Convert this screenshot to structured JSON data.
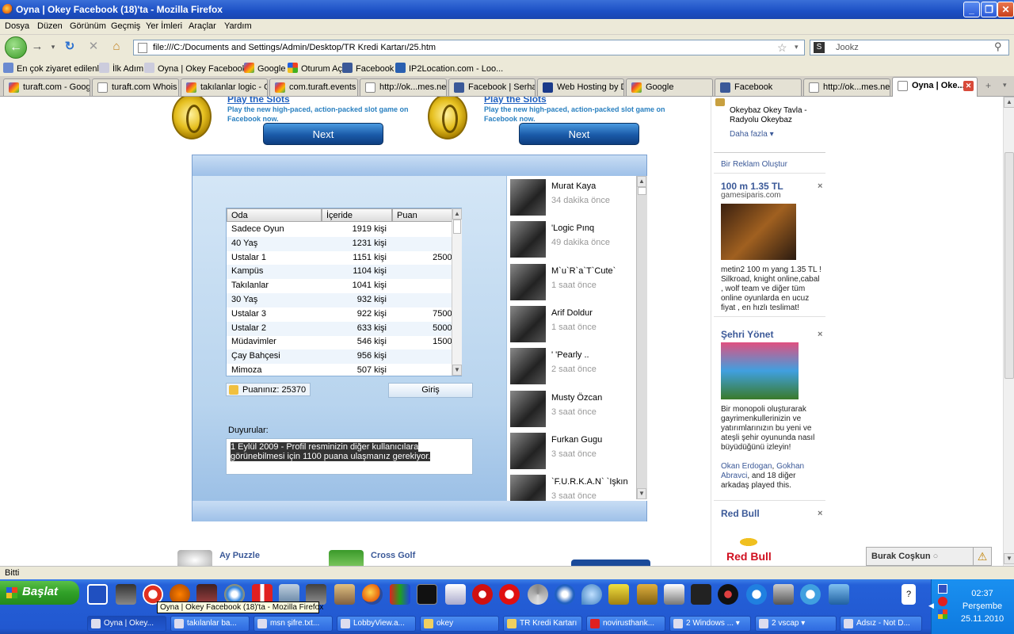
{
  "window": {
    "title": "Oyna | Okey Facebook (18)'ta - Mozilla Firefox"
  },
  "menu": [
    "Dosya",
    "Düzen",
    "Görünüm",
    "Geçmiş",
    "Yer İmleri",
    "Araçlar",
    "Yardım"
  ],
  "nav": {
    "url": "file:///C:/Documents and Settings/Admin/Desktop/TR Kredi Kartarı/25.htm",
    "search_placeholder": "Jookz"
  },
  "bookmarks": [
    "En çok ziyaret edilenler",
    "İlk Adım",
    "Oyna | Okey Facebook...",
    "Google",
    "Oturum Aç",
    "Facebook",
    "IP2Location.com - Loo..."
  ],
  "tabs": [
    "turaft.com - Googl...",
    "turaft.com Whois -...",
    "takılanlar logic - G...",
    "com.turaft.events -...",
    "http://ok...mes.net/",
    "Facebook | Serhat...",
    "Web Hosting by D...",
    "Google",
    "Facebook",
    "http://ok...mes.net/",
    "Oyna | Oke..."
  ],
  "promo": {
    "link": "Play the Slots",
    "desc1": "Play the new high-paced, action-packed slot game on",
    "desc2": "Facebook now.",
    "next": "Next"
  },
  "lobby": {
    "headers": [
      "Oda",
      "İçeride",
      "Puan"
    ],
    "rooms": [
      {
        "name": "Sadece Oyun",
        "count": "1919 kişi",
        "points": ""
      },
      {
        "name": "40 Yaş",
        "count": "1231 kişi",
        "points": ""
      },
      {
        "name": "Ustalar 1",
        "count": "1151 kişi",
        "points": "2500+"
      },
      {
        "name": "Kampüs",
        "count": "1104 kişi",
        "points": ""
      },
      {
        "name": "Takılanlar",
        "count": "1041 kişi",
        "points": ""
      },
      {
        "name": "30 Yaş",
        "count": "932 kişi",
        "points": ""
      },
      {
        "name": "Ustalar 3",
        "count": "922 kişi",
        "points": "7500+"
      },
      {
        "name": "Ustalar 2",
        "count": "633 kişi",
        "points": "5000+"
      },
      {
        "name": "Müdavimler",
        "count": "546 kişi",
        "points": "1500+"
      },
      {
        "name": "Çay Bahçesi",
        "count": "956 kişi",
        "points": ""
      },
      {
        "name": "Mimoza",
        "count": "507 kişi",
        "points": ""
      }
    ],
    "score": "Puanınız: 25370",
    "join": "Giriş",
    "announce_title": "Duyurular:",
    "announce_line1": "1 Eylül 2009 - Profil resminizin diğer kullanıcılara",
    "announce_line2": "görünebilmesi için 1100 puana ulaşmanız gerekiyor."
  },
  "friends": [
    {
      "name": "Murat Kaya",
      "time": "34 dakika önce"
    },
    {
      "name": "'Logic Pınq",
      "time": "49 dakika önce"
    },
    {
      "name": "M`u`R`a`T`Cute`",
      "time": "1 saat önce"
    },
    {
      "name": "Arif Doldur",
      "time": "1 saat önce"
    },
    {
      "name": "' 'Pearly ..",
      "time": "2 saat önce"
    },
    {
      "name": "Musty Özcan",
      "time": "3 saat önce"
    },
    {
      "name": "Furkan Gugu",
      "time": "3 saat önce"
    },
    {
      "name": "`F.U.R.K.A.N` `Işkın",
      "time": "3 saat önce"
    }
  ],
  "sidebar": {
    "okey_line1": "Okeybaz Okey Tavla -",
    "okey_line2": "Radyolu Okeybaz",
    "more": "Daha fazla",
    "create_ad": "Bir Reklam Oluştur",
    "ad1": {
      "title": "100 m 1.35 TL",
      "site": "gamesiparis.com",
      "text": "metin2 100 m yang 1.35 TL ! Silkroad, knight online,cabal , wolf team ve diğer tüm online oyunlarda en ucuz fiyat , en hızlı teslimat!"
    },
    "ad2": {
      "title": "Şehri Yönet",
      "text": "Bir monopoli oluşturarak gayrimenkullerinizin ve yatırımlarınızın bu yeni ve ateşli şehir oyununda nasıl büyüdüğünü izleyin!",
      "friends_a": "Okan Erdogan",
      "friends_b": "Gokhan Abravci",
      "friends_c": ", and 18 diğer arkadaş played this."
    },
    "ad3": {
      "title": "Red Bull",
      "logo": "Red Bull"
    }
  },
  "bottom_games": [
    "Ay Puzzle",
    "Cross Golf"
  ],
  "status": "Bitti",
  "chat": {
    "name": "Burak Coşkun"
  },
  "taskbar": {
    "start": "Başlat",
    "tooltip": "Oyna | Okey Facebook (18)'ta - Mozilla Firefox",
    "buttons": [
      "Oyna | Okey...",
      "takılanlar ba...",
      "msn şifre.txt...",
      "LobbyView.a...",
      "okey",
      "TR Kredi Kartarı",
      "novirusthank...",
      "2 Windows ...",
      "2 vscap",
      "Adsız - Not D..."
    ],
    "time": "02:37",
    "day": "Perşembe",
    "date": "25.11.2010"
  },
  "colors": {
    "title_blue": "#1c4fc4",
    "fb_blue": "#3b5998",
    "start_green": "#30a028",
    "next_blue": "#1a5aa8"
  }
}
